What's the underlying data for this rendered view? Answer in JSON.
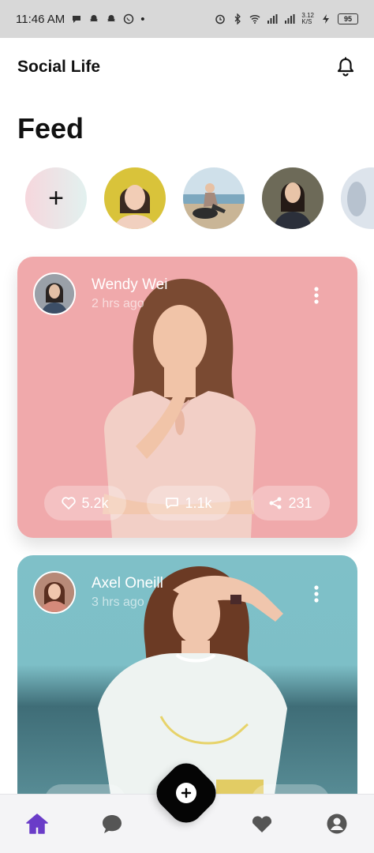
{
  "status_bar": {
    "time": "11:46 AM",
    "dot": "•",
    "net_speed_top": "3.12",
    "net_speed_bottom": "K/S",
    "battery": "95"
  },
  "header": {
    "title": "Social Life"
  },
  "feed": {
    "title": "Feed"
  },
  "stories": {
    "add_label": "+"
  },
  "posts": [
    {
      "name": "Wendy Wei",
      "time": "2 hrs ago",
      "likes": "5.2k",
      "comments": "1.1k",
      "shares": "231"
    },
    {
      "name": "Axel Oneill",
      "time": "3 hrs ago"
    }
  ],
  "colors": {
    "accent": "#6a3cc8",
    "nav_icon": "#555555",
    "card1_bg": "#f0a9ab",
    "card2_bg": "#7fc0c8"
  },
  "icons": [
    "bell-icon",
    "more-vertical-icon",
    "heart-icon",
    "comment-icon",
    "share-icon",
    "home-icon",
    "chat-icon",
    "add-icon",
    "user-icon"
  ]
}
